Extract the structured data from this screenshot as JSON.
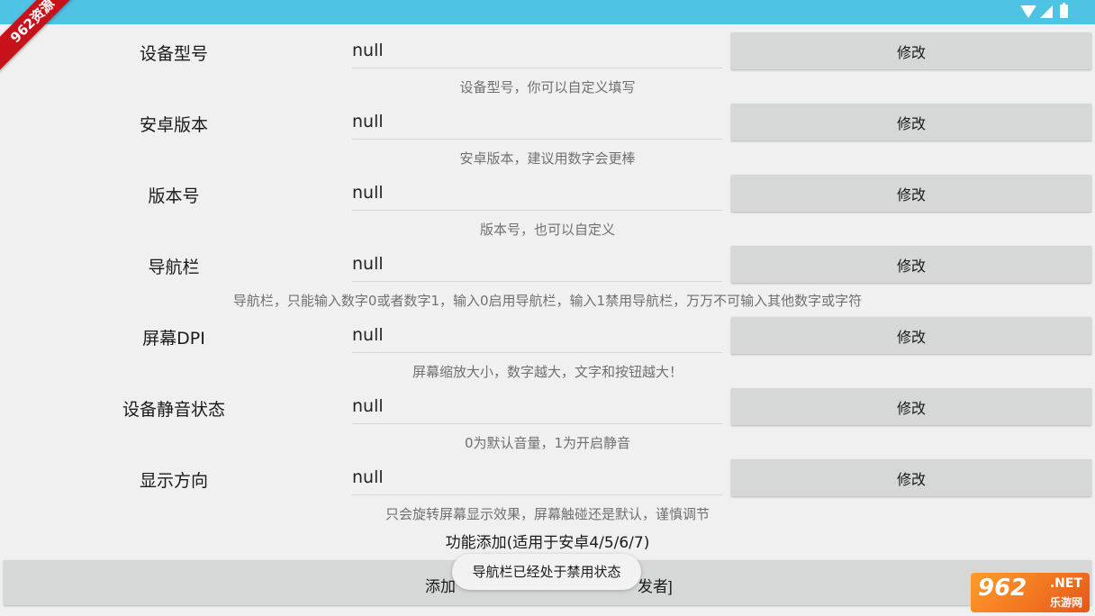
{
  "watermark_corner": "962资源",
  "rows": [
    {
      "label": "设备型号",
      "value": "null",
      "button": "修改",
      "hint": "设备型号，你可以自定义填写"
    },
    {
      "label": "安卓版本",
      "value": "null",
      "button": "修改",
      "hint": "安卓版本，建议用数字会更棒"
    },
    {
      "label": "版本号",
      "value": "null",
      "button": "修改",
      "hint": "版本号，也可以自定义"
    },
    {
      "label": "导航栏",
      "value": "null",
      "button": "修改",
      "hint": "导航栏，只能输入数字0或者数字1，输入0启用导航栏，输入1禁用导航栏，万万不可输入其他数字或字符"
    },
    {
      "label": "屏幕DPI",
      "value": "null",
      "button": "修改",
      "hint": "屏幕缩放大小，数字越大，文字和按钮越大！"
    },
    {
      "label": "设备静音状态",
      "value": "null",
      "button": "修改",
      "hint": "0为默认音量，1为开启静音"
    },
    {
      "label": "显示方向",
      "value": "null",
      "button": "修改",
      "hint": "只会旋转屏幕显示效果，屏幕触碰还是默认，谨慎调节"
    }
  ],
  "section_title": "功能添加(适用于安卓4/5/6/7)",
  "add_button": {
    "left_text": "添加",
    "right_text": "发者]"
  },
  "toast": "导航栏已经处于禁用状态",
  "watermark": {
    "big": "962",
    "net": ".NET",
    "cn": "乐游网"
  }
}
